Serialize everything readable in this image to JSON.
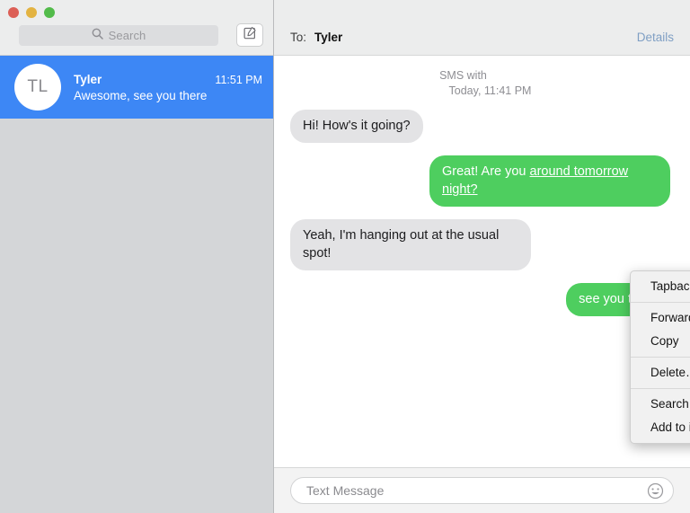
{
  "window": {
    "traffic_lights": [
      {
        "name": "close",
        "color": "#dc5f56"
      },
      {
        "name": "minimize",
        "color": "#e3b341"
      },
      {
        "name": "maximize",
        "color": "#52bb4a"
      }
    ]
  },
  "sidebar": {
    "search": {
      "placeholder": "Search",
      "value": ""
    },
    "compose_icon": "compose-icon",
    "conversations": [
      {
        "avatar_initials": "TL",
        "name": "Tyler",
        "time": "11:51 PM",
        "preview": "Awesome, see you there",
        "selected": true,
        "selected_color": "#3d87f5"
      }
    ]
  },
  "header": {
    "to_label": "To:",
    "recipient": "Tyler",
    "details_label": "Details",
    "details_color": "#7f9fc4"
  },
  "thread": {
    "stamp_line1": "SMS with",
    "stamp_line2": "Today, 11:41 PM",
    "messages": [
      {
        "direction": "in",
        "text": "Hi! How's it going?",
        "bubble_color": "#e3e3e5"
      },
      {
        "direction": "out",
        "text_plain": "Great! Are you ",
        "text_underlined": "around tomorrow night?",
        "bubble_color": "#4ece5f"
      },
      {
        "direction": "in",
        "text": "Yeah, I'm hanging out at the usual spot!",
        "bubble_color": "#e3e3e5"
      },
      {
        "direction": "out",
        "text": "see you there",
        "bubble_color": "#4ece5f"
      }
    ]
  },
  "context_menu": {
    "groups": [
      [
        "Tapback…"
      ],
      [
        "Forward…",
        "Copy"
      ],
      [
        "Delete…"
      ],
      [
        "Search With Google",
        "Add to iTunes as a Spoken Track"
      ]
    ]
  },
  "composer": {
    "placeholder": "Text Message",
    "value": "",
    "emoji_icon": "smiley-face-icon"
  }
}
